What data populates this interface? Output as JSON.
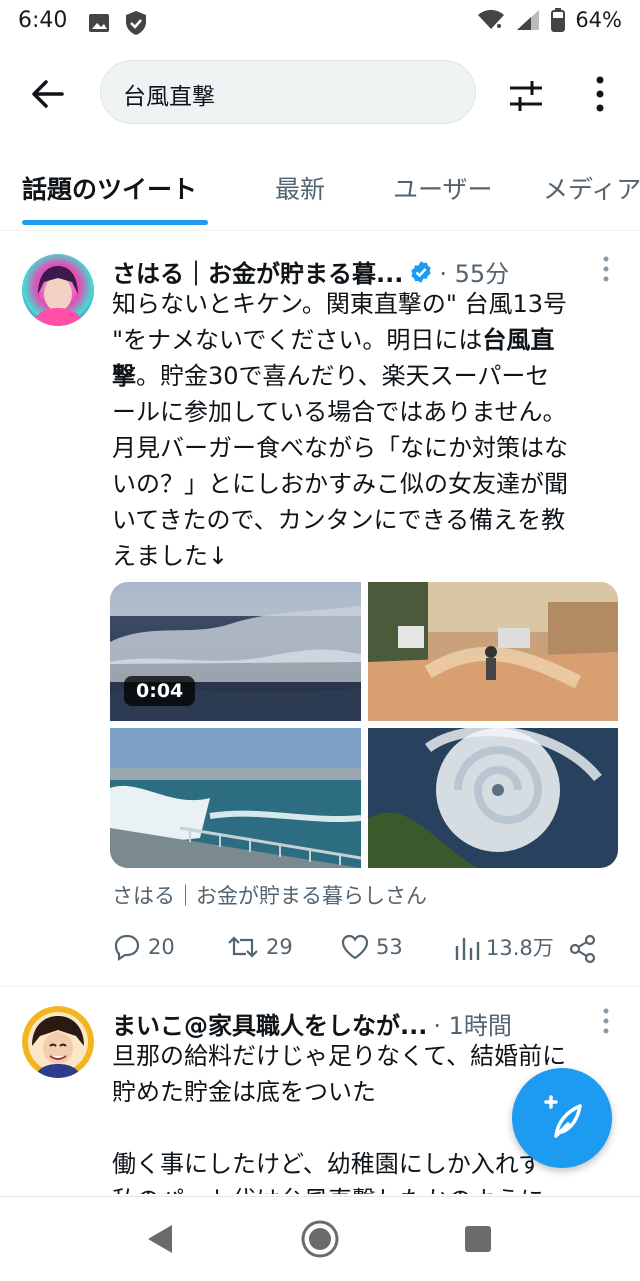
{
  "status": {
    "time": "6:40",
    "battery": "64%"
  },
  "search": {
    "query": "台風直撃"
  },
  "tabs": [
    {
      "label": "話題のツイート"
    },
    {
      "label": "最新"
    },
    {
      "label": "ユーザー"
    },
    {
      "label": "メディア"
    }
  ],
  "tweets": [
    {
      "author": "さはる｜お金が貯まる暮...",
      "time": "· 55分",
      "text_lines": [
        "知らないとキケン。関東直撃の\" 台風13号",
        "\"をナメないでください。明日には",
        "台風直",
        "撃",
        "。貯金30で喜んだり、楽天スーパーセ",
        "ールに参加している場合ではありません。",
        "月見バーガー食べながら「なにか対策はな",
        "いの？」とにしおかすみこ似の女友達が聞",
        "いてきたので、カンタンにできる備えを教",
        "えました↓"
      ],
      "video_duration": "0:04",
      "attribution": "さはる｜お金が貯まる暮らしさん",
      "replies": "20",
      "retweets": "29",
      "likes": "53",
      "views": "13.8万"
    },
    {
      "author": "まいこ@家具職人をしなが...",
      "time": "· 1時間",
      "text_lines": [
        "旦那の給料だけじゃ足りなくて、結婚前に",
        "貯めた貯金は底をついた",
        "",
        "働く事にしたけど、幼稚園にしか入れず",
        "私のパート代は台風直撃したかのように"
      ]
    }
  ],
  "colors": {
    "accent": "#1d9bf0",
    "text_primary": "#0f1419",
    "text_secondary": "#536471"
  },
  "icons": {
    "back": "arrow-left-icon",
    "filter": "sliders-icon",
    "more": "more-vertical-icon",
    "verified": "verified-badge-icon",
    "reply": "comment-icon",
    "retweet": "retweet-icon",
    "like": "heart-icon",
    "views": "bar-chart-icon",
    "share": "share-icon",
    "compose": "compose-tweet-icon"
  }
}
